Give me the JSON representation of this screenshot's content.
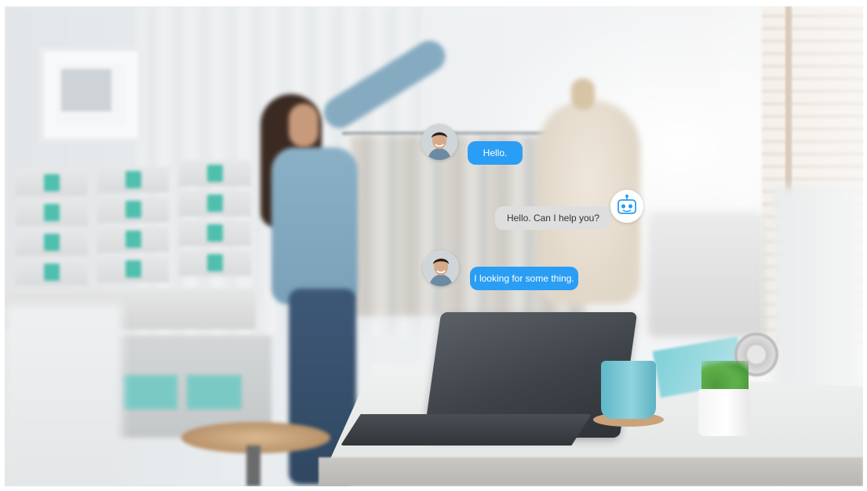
{
  "scene": {
    "description_hidden": ""
  },
  "chat": {
    "messages": [
      {
        "sender": "user",
        "text": "Hello."
      },
      {
        "sender": "bot",
        "text": "Hello. Can I help you?"
      },
      {
        "sender": "user",
        "text": "I looking for some thing."
      }
    ]
  },
  "icons": {
    "user_avatar": "person-avatar-icon",
    "bot_avatar": "robot-icon"
  },
  "colors": {
    "user_bubble": "#2a9df4",
    "bot_bubble": "#dedede",
    "bot_icon": "#2a9df4"
  }
}
